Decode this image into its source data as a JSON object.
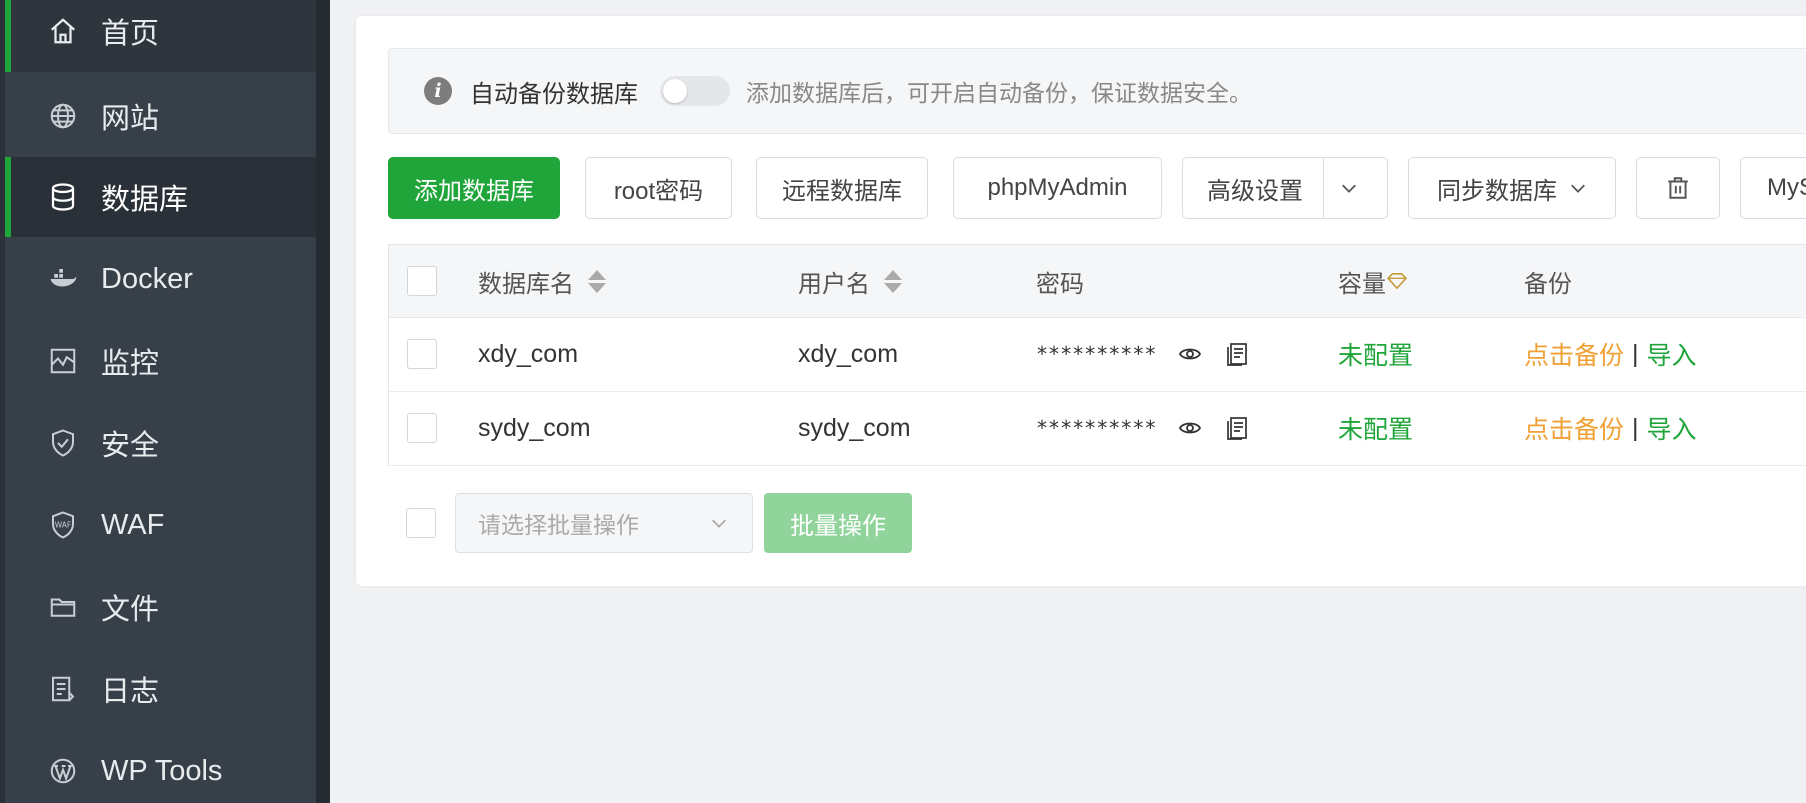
{
  "sidebar": {
    "items": [
      {
        "label": "首页",
        "icon": "home-icon"
      },
      {
        "label": "网站",
        "icon": "globe-icon"
      },
      {
        "label": "数据库",
        "icon": "database-icon"
      },
      {
        "label": "Docker",
        "icon": "docker-icon"
      },
      {
        "label": "监控",
        "icon": "monitor-icon"
      },
      {
        "label": "安全",
        "icon": "shield-icon"
      },
      {
        "label": "WAF",
        "icon": "waf-icon"
      },
      {
        "label": "文件",
        "icon": "folder-icon"
      },
      {
        "label": "日志",
        "icon": "log-icon"
      },
      {
        "label": "WP Tools",
        "icon": "wordpress-icon"
      }
    ],
    "active": "数据库"
  },
  "tips": {
    "label": "自动备份数据库",
    "hint": "添加数据库后，可开启自动备份，保证数据安全。",
    "toggle_on": false
  },
  "toolbar": {
    "add": "添加数据库",
    "root_password": "root密码",
    "remote_db": "远程数据库",
    "phpmyadmin": "phpMyAdmin",
    "advanced": "高级设置",
    "sync": "同步数据库",
    "mysql_partial": "MyS"
  },
  "table": {
    "headers": {
      "name": "数据库名",
      "user": "用户名",
      "password": "密码",
      "capacity": "容量",
      "backup": "备份"
    },
    "rows": [
      {
        "name": "xdy_com",
        "user": "xdy_com",
        "password": "**********",
        "capacity": "未配置",
        "backup": "点击备份",
        "import": "导入"
      },
      {
        "name": "sydy_com",
        "user": "sydy_com",
        "password": "**********",
        "capacity": "未配置",
        "backup": "点击备份",
        "import": "导入"
      }
    ]
  },
  "batch": {
    "placeholder": "请选择批量操作",
    "button": "批量操作"
  },
  "colors": {
    "accent": "#20a53a",
    "sidebar": "#373f48",
    "backup_link": "#f0a035"
  }
}
